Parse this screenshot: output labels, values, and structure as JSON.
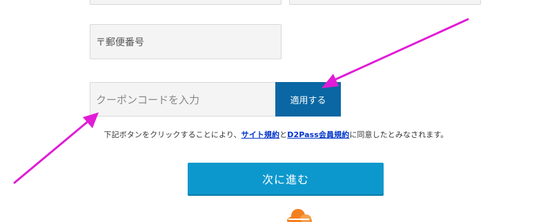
{
  "form": {
    "postal_placeholder": "〒郵便番号",
    "coupon_placeholder": "クーポンコードを入力",
    "apply_label": "適用する"
  },
  "terms": {
    "prefix": "下記ボタンをクリックすることにより、",
    "link1": "サイト規約",
    "middle": "と",
    "link2": "D2Pass会員規約",
    "suffix": "に同意したとみなされます。"
  },
  "next_label": "次に進む",
  "colors": {
    "apply_button": "#0a67a3",
    "next_button": "#0d98cd",
    "link": "#0033cc",
    "arrow": "#e11bd6",
    "cloudflare_orange": "#f38020"
  },
  "icons": {
    "logo": "cloudflare-cloud-icon"
  }
}
